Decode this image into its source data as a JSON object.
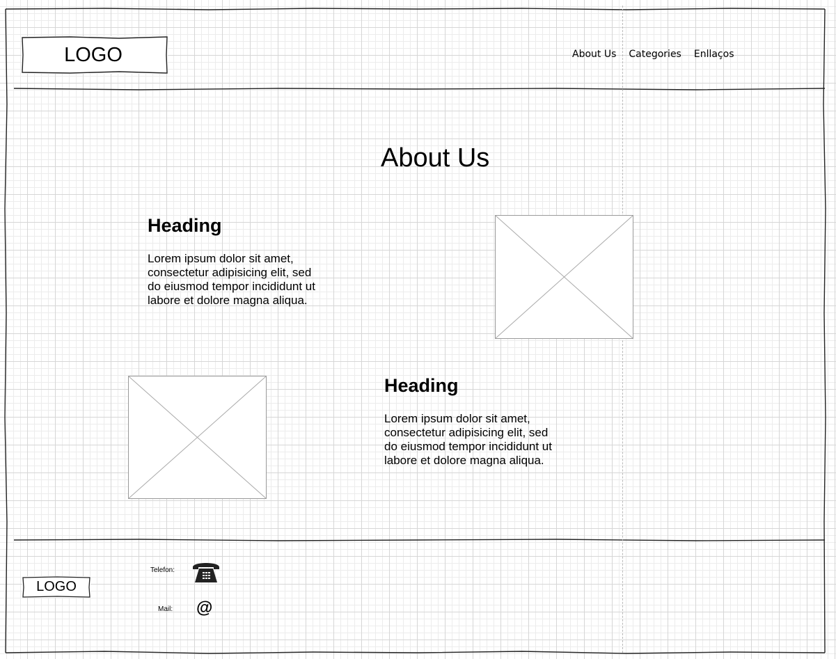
{
  "header": {
    "logo": "LOGO",
    "nav": [
      "About Us",
      "Categories",
      "Enllaços"
    ]
  },
  "main": {
    "title": "About Us",
    "sections": [
      {
        "heading": "Heading",
        "text": "Lorem ipsum dolor sit amet,\nconsectetur adipisicing elit, sed\ndo eiusmod tempor incididunt ut\nlabore et dolore magna aliqua."
      },
      {
        "heading": "Heading",
        "text": "Lorem ipsum dolor sit amet,\nconsectetur adipisicing elit, sed\ndo eiusmod tempor incididunt ut\nlabore et dolore magna aliqua."
      }
    ]
  },
  "footer": {
    "logo": "LOGO",
    "phone_label": "Telefon:",
    "mail_label": "Mail:",
    "mail_symbol": "@",
    "icons": [
      "telephone-icon",
      "at-sign-icon"
    ]
  }
}
